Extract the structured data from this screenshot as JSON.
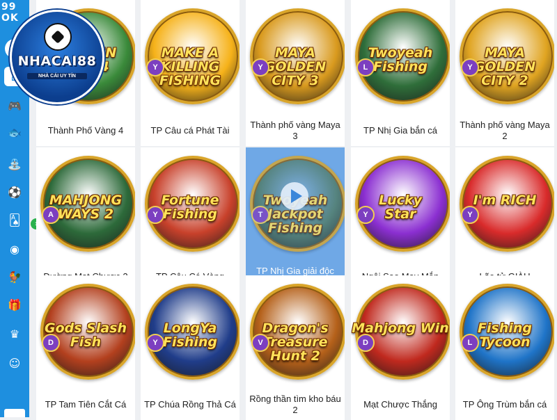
{
  "sidebar": {
    "brand_top": "99",
    "brand_bottom": "OK",
    "items": [
      {
        "icon": "user-icon",
        "glyph": "👤"
      },
      {
        "icon": "home-icon",
        "glyph": "⌂"
      },
      {
        "icon": "gamepad-icon",
        "glyph": "🎮"
      },
      {
        "icon": "fish-icon",
        "glyph": "🐟"
      },
      {
        "icon": "lottery-icon",
        "glyph": "⛲"
      },
      {
        "icon": "football-icon",
        "glyph": "⚽"
      },
      {
        "icon": "cards-icon",
        "glyph": "🂡"
      },
      {
        "icon": "coin-icon",
        "glyph": "◉"
      },
      {
        "icon": "cockfight-icon",
        "glyph": "🐓"
      },
      {
        "icon": "gift-icon",
        "glyph": "🎁"
      },
      {
        "icon": "vip-icon",
        "glyph": "♛"
      },
      {
        "icon": "support-icon",
        "glyph": "☺"
      }
    ],
    "toggle_glyph": "›"
  },
  "logo": {
    "name": "NHACAI88",
    "slogan": "NHÀ CÁI UY TÍN"
  },
  "games": [
    {
      "title": "Thành Phố Vàng 4",
      "logo_text": "GOLDEN\nCITY 4",
      "provider": "",
      "color": "#3a8a3a"
    },
    {
      "title": "TP Câu cá Phát Tài",
      "logo_text": "MAKE A\nKILLING\nFISHING",
      "provider": "Y",
      "color": "#f6b21a"
    },
    {
      "title": "Thành phố vàng Maya 3",
      "logo_text": "MAYA\nGOLDEN CITY 3",
      "provider": "Y",
      "color": "#d99a1e"
    },
    {
      "title": "TP Nhị Gia bắn cá",
      "logo_text": "Twoyeah\nFishing",
      "provider": "L",
      "color": "#2f6e3a"
    },
    {
      "title": "Thành phố vàng Maya 2",
      "logo_text": "MAYA\nGOLDEN CITY 2",
      "provider": "Y",
      "color": "#e0a421"
    },
    {
      "title": "Đường Mạt Chược 2",
      "logo_text": "MAHJONG\nWAYS 2",
      "provider": "A",
      "color": "#2d6a3a"
    },
    {
      "title": "TP Câu Cá Vàng",
      "logo_text": "Fortune\nFishing",
      "provider": "Y",
      "color": "#c8412b"
    },
    {
      "title": "TP Nhị Gia giải độc đắc bắn cá",
      "logo_text": "Twoyeah\nJackpot Fishing",
      "provider": "T",
      "color": "#4f7a64",
      "hovered": true
    },
    {
      "title": "Ngôi Sao May Mắn",
      "logo_text": "Lucky\nStar",
      "provider": "Y",
      "color": "#8b2fd1"
    },
    {
      "title": "Lão tử GIÀU",
      "logo_text": "I'm RICH",
      "provider": "Y",
      "color": "#d92b2b"
    },
    {
      "title": "TP Tam Tiên Cắt Cá",
      "logo_text": "Gods Slash Fish",
      "provider": "D",
      "color": "#b3401e"
    },
    {
      "title": "TP Chúa Rồng Thả Cá",
      "logo_text": "LongYa\nFishing",
      "provider": "Y",
      "color": "#203d8a"
    },
    {
      "title": "Rồng thần tìm kho báu 2",
      "logo_text": "Dragon's\nTreasure Hunt 2",
      "provider": "V",
      "color": "#b5611a"
    },
    {
      "title": "Mạt Chược Thắng",
      "logo_text": "Mahjong Win",
      "provider": "D",
      "color": "#c0291e"
    },
    {
      "title": "TP Ông Trùm bắn cá",
      "logo_text": "Fishing\nTycoon",
      "provider": "L",
      "color": "#1f74c8"
    }
  ],
  "colors": {
    "sidebar": "#1e8fdf",
    "background": "#eef0f3",
    "hover": "#6fa8e6",
    "toggle": "#2ab24d"
  }
}
